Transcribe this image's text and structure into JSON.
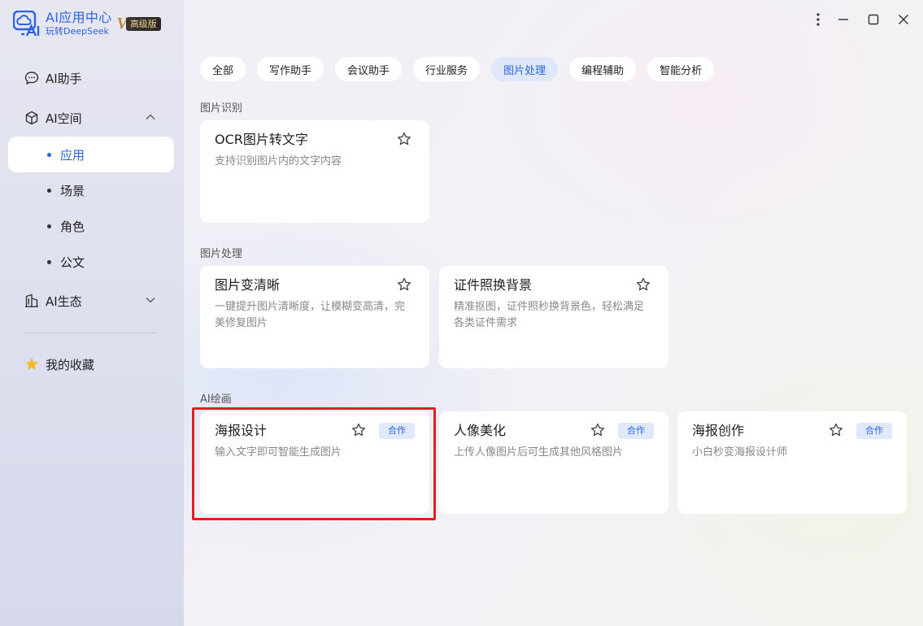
{
  "logo": {
    "title": "AI应用中心",
    "subtitle": "玩转DeepSeek",
    "badge": "高级版"
  },
  "nav": {
    "assistant": "AI助手",
    "space": "AI空间",
    "space_children": [
      "应用",
      "场景",
      "角色",
      "公文"
    ],
    "ecosystem": "AI生态",
    "favorites": "我的收藏"
  },
  "tabs": [
    "全部",
    "写作助手",
    "会议助手",
    "行业服务",
    "图片处理",
    "编程辅助",
    "智能分析"
  ],
  "active_tab": "图片处理",
  "sections": [
    {
      "label": "图片识别",
      "cards": [
        {
          "title": "OCR图片转文字",
          "desc": "支持识别图片内的文字内容"
        }
      ]
    },
    {
      "label": "图片处理",
      "cards": [
        {
          "title": "图片变清晰",
          "desc": "一键提升图片清晰度，让模糊变高清，完美修复图片"
        },
        {
          "title": "证件照换背景",
          "desc": "精准抠图，证件照秒换背景色，轻松满足各类证件需求"
        }
      ]
    },
    {
      "label": "AI绘画",
      "cards": [
        {
          "title": "海报设计",
          "desc": "输入文字即可智能生成图片",
          "tag": "合作"
        },
        {
          "title": "人像美化",
          "desc": "上传人像图片后可生成其他风格图片",
          "tag": "合作"
        },
        {
          "title": "海报创作",
          "desc": "小白秒变海报设计师",
          "tag": "合作"
        }
      ]
    }
  ],
  "colors": {
    "accent": "#2b63e0",
    "highlight": "#e0201f",
    "tag_bg": "#e0e9fb"
  }
}
